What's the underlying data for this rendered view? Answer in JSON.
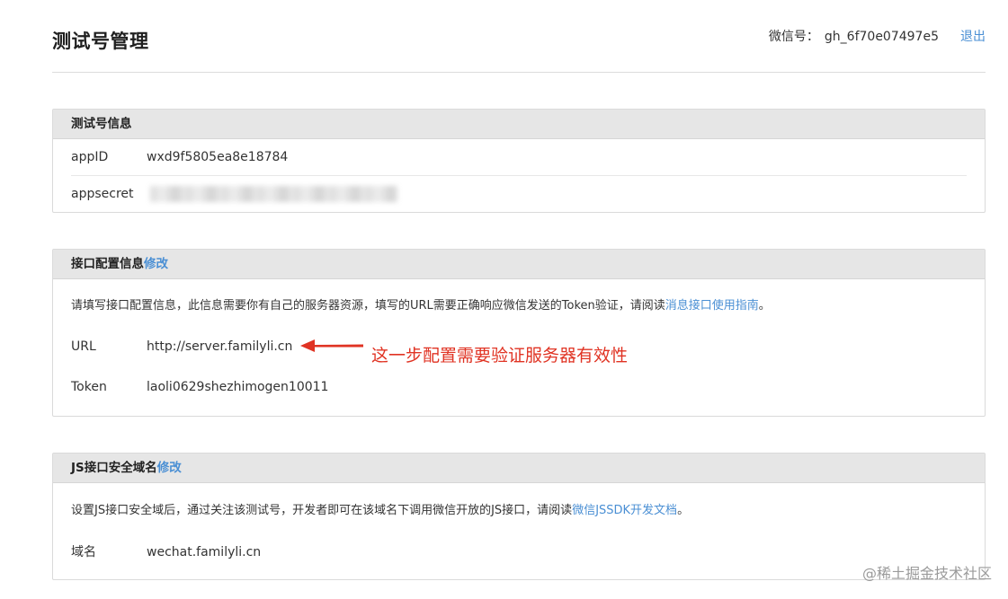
{
  "header": {
    "title": "测试号管理",
    "account_label": "微信号：",
    "account_value": "gh_6f70e07497e5",
    "logout": "退出"
  },
  "test_account": {
    "title": "测试号信息",
    "appid_label": "appID",
    "appid_value": "wxd9f5805ea8e18784",
    "appsecret_label": "appsecret"
  },
  "interface_config": {
    "title": "接口配置信息",
    "edit": "修改",
    "description": "请填写接口配置信息，此信息需要你有自己的服务器资源，填写的URL需要正确响应微信发送的Token验证，请阅读",
    "guide_link": "消息接口使用指南",
    "description_end": "。",
    "url_label": "URL",
    "url_value": "http://server.familyli.cn",
    "token_label": "Token",
    "token_value": "laoli0629shezhimogen10011"
  },
  "annotation": {
    "text": "这一步配置需要验证服务器有效性",
    "color": "#e03323"
  },
  "js_domain": {
    "title": "JS接口安全域名",
    "edit": "修改",
    "description": "设置JS接口安全域后，通过关注该测试号，开发者即可在该域名下调用微信开放的JS接口，请阅读",
    "doc_link": "微信JSSDK开发文档",
    "description_end": "。",
    "domain_label": "域名",
    "domain_value": "wechat.familyli.cn"
  },
  "watermark": "@稀土掘金技术社区",
  "colors": {
    "link": "#4a8fd4",
    "panel_header": "#e6e6e6",
    "annotation": "#e03323"
  }
}
